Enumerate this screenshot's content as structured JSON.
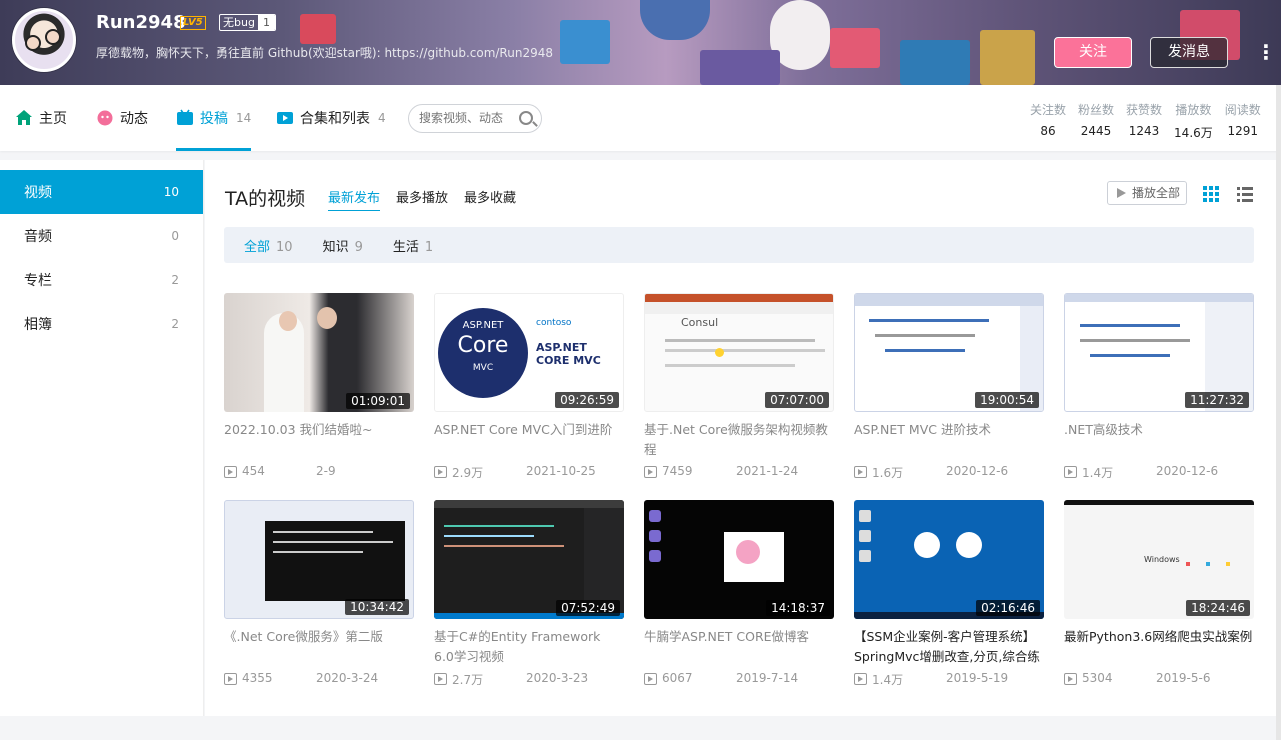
{
  "profile": {
    "name": "Run2948",
    "level": "LV5",
    "tag_label": "无bug",
    "tag_count": "1",
    "sign": "厚德载物，胸怀天下，勇往直前 Github(欢迎star哦): https://github.com/Run2948",
    "follow_label": "关注",
    "message_label": "发消息",
    "more_label": "⋮"
  },
  "nav": {
    "items": [
      {
        "label": "主页",
        "count": "",
        "icon": "home-icon"
      },
      {
        "label": "动态",
        "count": "",
        "icon": "dynamic-icon"
      },
      {
        "label": "投稿",
        "count": "14",
        "icon": "upload-icon"
      },
      {
        "label": "合集和列表",
        "count": "4",
        "icon": "collection-icon"
      }
    ],
    "active": "投稿",
    "search_placeholder": "搜索视频、动态",
    "stats": [
      {
        "label": "关注数",
        "value": "86"
      },
      {
        "label": "粉丝数",
        "value": "2445"
      },
      {
        "label": "获赞数",
        "value": "1243"
      },
      {
        "label": "播放数",
        "value": "14.6万"
      },
      {
        "label": "阅读数",
        "value": "1291"
      }
    ]
  },
  "sidebar": {
    "items": [
      {
        "label": "视频",
        "count": "10"
      },
      {
        "label": "音频",
        "count": "0"
      },
      {
        "label": "专栏",
        "count": "2"
      },
      {
        "label": "相簿",
        "count": "2"
      }
    ]
  },
  "main": {
    "title": "TA的视频",
    "sorts": [
      "最新发布",
      "最多播放",
      "最多收藏"
    ],
    "play_all": "播放全部",
    "filters": [
      {
        "label": "全部",
        "count": "10"
      },
      {
        "label": "知识",
        "count": "9"
      },
      {
        "label": "生活",
        "count": "1"
      }
    ],
    "videos": [
      {
        "title": "2022.10.03 我们结婚啦~",
        "duration": "01:09:01",
        "plays": "454",
        "date": "2-9"
      },
      {
        "title": "ASP.NET Core MVC入门到进阶",
        "duration": "09:26:59",
        "plays": "2.9万",
        "date": "2021-10-25"
      },
      {
        "title": "基于.Net Core微服务架构视频教程",
        "duration": "07:07:00",
        "plays": "7459",
        "date": "2021-1-24"
      },
      {
        "title": "ASP.NET MVC 进阶技术",
        "duration": "19:00:54",
        "plays": "1.6万",
        "date": "2020-12-6"
      },
      {
        "title": ".NET高级技术",
        "duration": "11:27:32",
        "plays": "1.4万",
        "date": "2020-12-6"
      },
      {
        "title": "《.Net Core微服务》第二版",
        "duration": "10:34:42",
        "plays": "4355",
        "date": "2020-3-24"
      },
      {
        "title": "基于C#的Entity Framework 6.0学习视频",
        "duration": "07:52:49",
        "plays": "2.7万",
        "date": "2020-3-23"
      },
      {
        "title": "牛腩学ASP.NET CORE做博客",
        "duration": "14:18:37",
        "plays": "6067",
        "date": "2019-7-14"
      },
      {
        "title": "【SSM企业案例-客户管理系统】SpringMvc增删改查,分页,综合练习",
        "duration": "02:16:46",
        "plays": "1.4万",
        "date": "2019-5-19"
      },
      {
        "title": "最新Python3.6网络爬虫实战案例",
        "duration": "18:24:46",
        "plays": "5304",
        "date": "2019-5-6"
      }
    ],
    "thumb_text": {
      "core_badge": "ASP.NET",
      "core_big": "Core",
      "core_small": "MVC",
      "core_brand": "contoso",
      "core_title": "ASP.NET CORE MVC",
      "consul": "Consul",
      "windows": "Windows"
    }
  },
  "colors": {
    "accent": "#00a1d6",
    "pink": "#fb7299"
  }
}
